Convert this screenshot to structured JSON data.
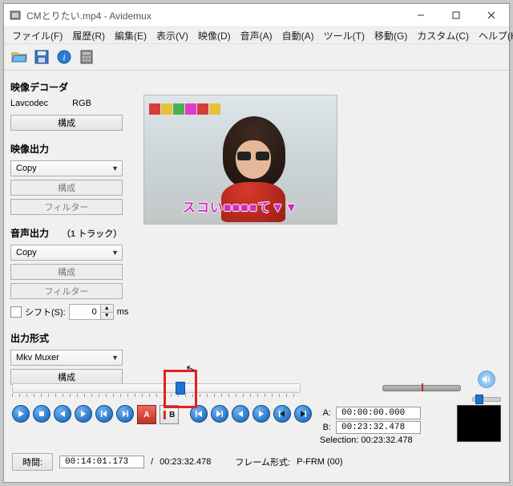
{
  "window": {
    "title": "CMとりたい.mp4 - Avidemux"
  },
  "menu": {
    "file": "ファイル(F)",
    "recent": "履歴(R)",
    "edit": "編集(E)",
    "view": "表示(V)",
    "video": "映像(D)",
    "audio": "音声(A)",
    "auto": "自動(A)",
    "tools": "ツール(T)",
    "go": "移動(G)",
    "custom": "カスタム(C)",
    "help": "ヘルプ(H)"
  },
  "decoder": {
    "title": "映像デコーダ",
    "codec": "Lavcodec",
    "colorspace": "RGB",
    "configure": "構成"
  },
  "video_out": {
    "title": "映像出力",
    "mode": "Copy",
    "configure": "構成",
    "filter": "フィルター"
  },
  "audio_out": {
    "title": "音声出力",
    "tracks": "（1 トラック）",
    "mode": "Copy",
    "configure": "構成",
    "filter": "フィルター",
    "shift_label": "シフト(S):",
    "shift_value": "0",
    "shift_unit": "ms"
  },
  "output_format": {
    "title": "出力形式",
    "mode": "Mkv Muxer",
    "configure": "構成"
  },
  "preview": {
    "caption": "スコい■■■■て▼▼"
  },
  "timeline": {
    "position_percent": 58
  },
  "markers": {
    "a_label": "A:",
    "a_time": "00:00:00.000",
    "b_label": "B:",
    "b_time": "00:23:32.478",
    "selection_label": "Selection:",
    "selection_time": "00:23:32.478"
  },
  "status": {
    "time_btn": "時間:",
    "current_time": "00:14:01.173",
    "sep": "/",
    "total_time": "00:23:32.478",
    "frame_type_label": "フレーム形式:",
    "frame_type_value": "P-FRM (00)"
  }
}
